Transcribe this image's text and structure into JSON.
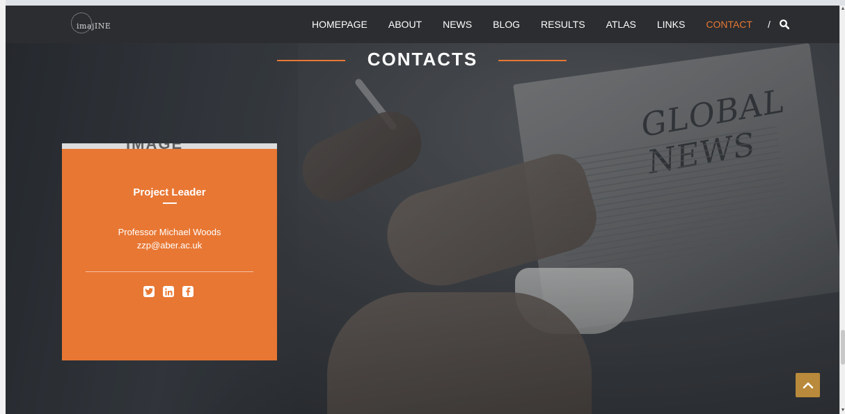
{
  "logo": {
    "text": "imajINE",
    "icon": "stars-ring-logo-icon"
  },
  "nav": {
    "items": [
      "HOMEPAGE",
      "ABOUT",
      "NEWS",
      "BLOG",
      "RESULTS",
      "ATLAS",
      "LINKS",
      "CONTACT"
    ],
    "active": "CONTACT",
    "separator": "/",
    "search_icon": "search-icon"
  },
  "section": {
    "title": "CONTACTS"
  },
  "card": {
    "photo_text": "IMAGE",
    "role": "Project Leader",
    "name": "Professor Michael Woods",
    "email": "zzp@aber.ac.uk",
    "social": [
      "twitter-icon",
      "linkedin-icon",
      "facebook-icon"
    ]
  },
  "back_to_top": {
    "icon": "chevron-up-icon"
  },
  "colors": {
    "accent": "#e87733",
    "nav_bg": "#2b2d30",
    "back_to_top": "#b98a3b"
  }
}
